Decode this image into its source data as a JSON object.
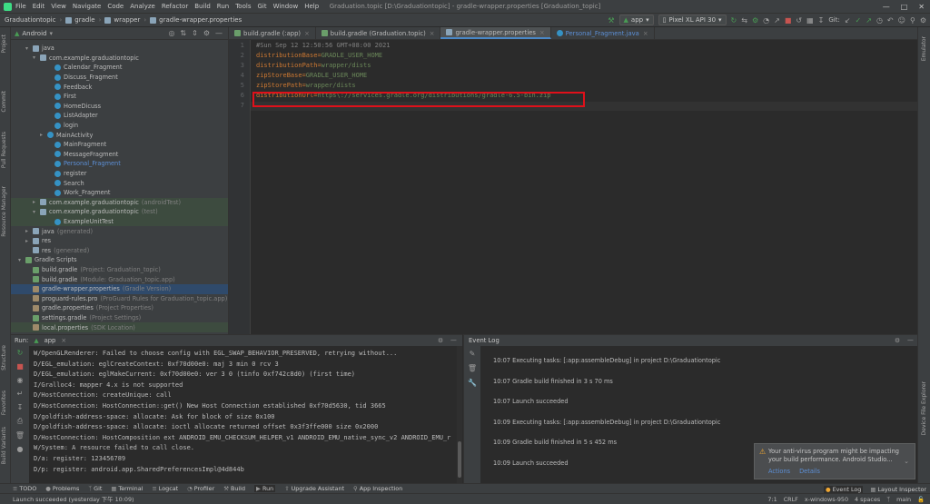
{
  "menu": {
    "items": [
      "File",
      "Edit",
      "View",
      "Navigate",
      "Code",
      "Analyze",
      "Refactor",
      "Build",
      "Run",
      "Tools",
      "Git",
      "Window",
      "Help"
    ],
    "window_title": "Graduation.topic [D:\\Graduationtopic] - gradle-wrapper.properties [Graduation_topic]"
  },
  "breadcrumb": [
    "Graduationtopic",
    "gradle",
    "wrapper",
    "gradle-wrapper.properties"
  ],
  "toolbar": {
    "run_config": "app",
    "device": "Pixel XL API 30",
    "git_label": "Git:"
  },
  "project_panel": {
    "view_mode": "Android",
    "tree": [
      {
        "label": "java",
        "indent": 2,
        "arrow": "down",
        "icon": "folder"
      },
      {
        "label": "com.example.graduationtopic",
        "indent": 3,
        "arrow": "down",
        "icon": "package"
      },
      {
        "label": "Calendar_Fragment",
        "indent": 5,
        "icon": "class"
      },
      {
        "label": "Discuss_Fragment",
        "indent": 5,
        "icon": "class"
      },
      {
        "label": "Feedback",
        "indent": 5,
        "icon": "class"
      },
      {
        "label": "First",
        "indent": 5,
        "icon": "class"
      },
      {
        "label": "HomeDicuss",
        "indent": 5,
        "icon": "class"
      },
      {
        "label": "ListAdapter",
        "indent": 5,
        "icon": "class"
      },
      {
        "label": "login",
        "indent": 5,
        "icon": "class"
      },
      {
        "label": "MainActivity",
        "indent": 4,
        "arrow": "right",
        "icon": "class"
      },
      {
        "label": "MainFragment",
        "indent": 5,
        "icon": "class"
      },
      {
        "label": "MessageFragment",
        "indent": 5,
        "icon": "class"
      },
      {
        "label": "Personal_Fragment",
        "indent": 5,
        "icon": "class",
        "blue": true
      },
      {
        "label": "register",
        "indent": 5,
        "icon": "class"
      },
      {
        "label": "Search",
        "indent": 5,
        "icon": "class"
      },
      {
        "label": "Work_Fragment",
        "indent": 5,
        "icon": "class"
      },
      {
        "label": "com.example.graduationtopic",
        "suffix": "(androidTest)",
        "indent": 3,
        "arrow": "right",
        "icon": "package",
        "hl": "test"
      },
      {
        "label": "com.example.graduationtopic",
        "suffix": "(test)",
        "indent": 3,
        "arrow": "down",
        "icon": "package",
        "hl": "test"
      },
      {
        "label": "ExampleUnitTest",
        "indent": 5,
        "icon": "class",
        "hl": "test"
      },
      {
        "label": "java",
        "suffix": "(generated)",
        "indent": 2,
        "arrow": "right",
        "icon": "folder"
      },
      {
        "label": "res",
        "indent": 2,
        "arrow": "right",
        "icon": "folder"
      },
      {
        "label": "res",
        "suffix": "(generated)",
        "indent": 2,
        "icon": "folder"
      },
      {
        "label": "Gradle Scripts",
        "indent": 1,
        "arrow": "down",
        "icon": "gradle"
      },
      {
        "label": "build.gradle",
        "suffix": "(Project: Graduation_topic)",
        "indent": 2,
        "icon": "gradle"
      },
      {
        "label": "build.gradle",
        "suffix": "(Module: Graduation_topic.app)",
        "indent": 2,
        "icon": "gradle"
      },
      {
        "label": "gradle-wrapper.properties",
        "suffix": "(Gradle Version)",
        "indent": 2,
        "icon": "props",
        "hl": "sel"
      },
      {
        "label": "proguard-rules.pro",
        "suffix": "(ProGuard Rules for Graduation_topic.app)",
        "indent": 2,
        "icon": "props"
      },
      {
        "label": "gradle.properties",
        "suffix": "(Project Properties)",
        "indent": 2,
        "icon": "props"
      },
      {
        "label": "settings.gradle",
        "suffix": "(Project Settings)",
        "indent": 2,
        "icon": "gradle"
      },
      {
        "label": "local.properties",
        "suffix": "(SDK Location)",
        "indent": 2,
        "icon": "props",
        "hl": "test"
      }
    ]
  },
  "editor": {
    "tabs": [
      {
        "label": "build.gradle (:app)",
        "active": false
      },
      {
        "label": "build.gradle (Graduation.topic)",
        "active": false
      },
      {
        "label": "gradle-wrapper.properties",
        "active": true
      },
      {
        "label": "Personal_Fragment.java",
        "active": false,
        "blue": true
      }
    ],
    "lines": [
      {
        "n": "1",
        "kind": "comment",
        "text": "#Sun Sep 12 12:50:56 GMT+08:00 2021"
      },
      {
        "n": "2",
        "key": "distributionBase",
        "val": "GRADLE_USER_HOME"
      },
      {
        "n": "3",
        "key": "distributionPath",
        "val": "wrapper/dists"
      },
      {
        "n": "4",
        "key": "zipStoreBase",
        "val": "GRADLE_USER_HOME"
      },
      {
        "n": "5",
        "key": "zipStorePath",
        "val": "wrapper/dists"
      },
      {
        "n": "6",
        "key": "distributionUrl",
        "val": "https\\://services.gradle.org/distributions/gradle-6.5-bin.zip"
      },
      {
        "n": "7",
        "kind": "empty",
        "text": ""
      }
    ]
  },
  "run_panel": {
    "title": "Run:",
    "config": "app",
    "lines": [
      "W/OpenGLRenderer: Failed to choose config with EGL_SWAP_BEHAVIOR_PRESERVED, retrying without...",
      "D/EGL_emulation: eglCreateContext: 0xf70d00e0: maj 3 min 0 rcv 3",
      "D/EGL_emulation: eglMakeCurrent: 0xf70d00e0: ver 3 0 (tinfo 0xf742c8d0) (first time)",
      "I/Gralloc4: mapper 4.x is not supported",
      "D/HostConnection: createUnique: call",
      "D/HostConnection: HostConnection::get() New Host Connection established 0xf70d5630, tid 3665",
      "D/goldfish-address-space: allocate: Ask for block of size 0x100",
      "D/goldfish-address-space: allocate: ioctl allocate returned offset 0x3f3ffe000 size 0x2000",
      "D/HostConnection: HostComposition ext ANDROID_EMU_CHECKSUM_HELPER_v1 ANDROID_EMU_native_sync_v2 ANDROID_EMU_r",
      "W/System: A resource failed to call close.",
      "D/a: register: 123456789",
      "D/p: register: android.app.SharedPreferencesImpl@4d844b"
    ]
  },
  "event_log": {
    "title": "Event Log",
    "entries": [
      {
        "time": "10:07",
        "text": "Executing tasks: [:app:assembleDebug] in project D:\\Graduationtopic"
      },
      {
        "time": "10:07",
        "text": "Gradle build finished in 3 s 70 ms"
      },
      {
        "time": "10:07",
        "text": "Launch succeeded"
      },
      {
        "time": "10:09",
        "text": "Executing tasks: [:app:assembleDebug] in project D:\\Graduationtopic"
      },
      {
        "time": "10:09",
        "text": "Gradle build finished in 5 s 452 ms"
      },
      {
        "time": "10:09",
        "text": "Launch succeeded"
      }
    ]
  },
  "notification": {
    "message": "Your anti-virus program might be impacting your build performance. Android Studio...",
    "action1": "Actions",
    "action2": "Details"
  },
  "bottom_tabs": [
    "TODO",
    "Problems",
    "Git",
    "Terminal",
    "Logcat",
    "Profiler",
    "Build",
    "Run",
    "Upgrade Assistant",
    "App Inspection"
  ],
  "bottom_right_tabs": [
    "Event Log",
    "Layout Inspector"
  ],
  "left_stripe": [
    "Project",
    "Commit",
    "Pull Requests",
    "Resource Manager",
    "Structure",
    "Favorites",
    "Build Variants"
  ],
  "right_stripe": [
    "Emulator",
    "Device File Explorer"
  ],
  "status": {
    "message": "Launch succeeded (yesterday 下午 10:09)",
    "position": "7:1",
    "line_sep": "CRLF",
    "encoding": "x-windows-950",
    "indent": "4 spaces",
    "branch": "main"
  }
}
